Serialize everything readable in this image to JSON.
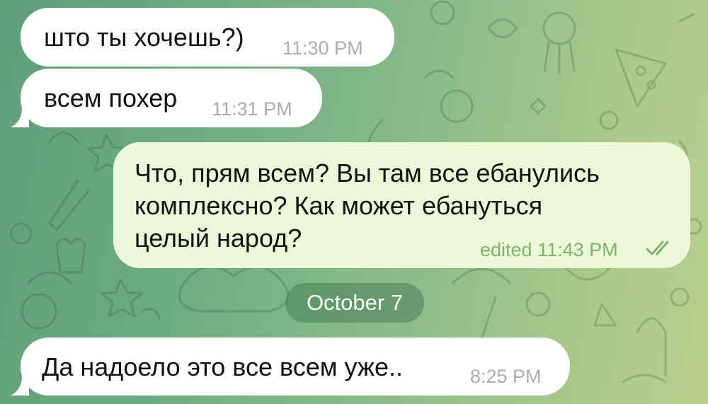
{
  "chat": {
    "background_color": "#7fb184",
    "messages": [
      {
        "direction": "incoming",
        "text": "што ты хочешь?)",
        "time": "11:30 PM"
      },
      {
        "direction": "incoming",
        "text": "всем похер",
        "time": "11:31 PM"
      },
      {
        "direction": "outgoing",
        "lines": [
          "Что, прям всем? Вы там все ебанулись",
          "комплексно? Как может ебануться",
          "целый народ?"
        ],
        "meta": "edited 11:43 PM",
        "status_icon": "double-check-icon"
      },
      {
        "direction": "incoming",
        "text": "Да надоело это все всем уже..",
        "time": "8:25 PM"
      }
    ],
    "date_separator": "October 7",
    "colors": {
      "incoming_bubble": "#ffffff",
      "outgoing_bubble": "#edf8d8",
      "outgoing_meta": "#7fb36c",
      "time_gray": "#a7aeb4"
    }
  }
}
